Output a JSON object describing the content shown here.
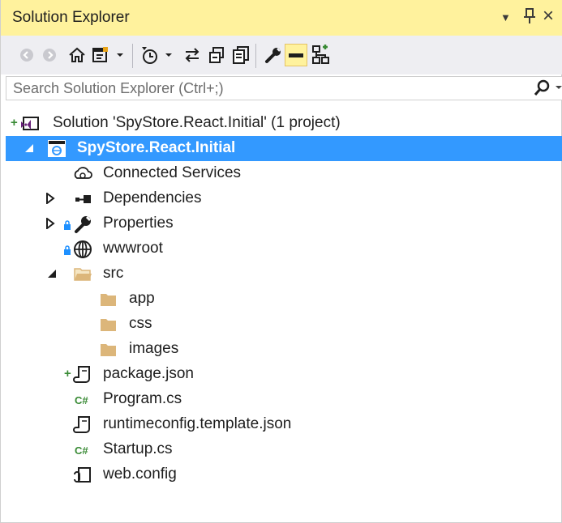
{
  "window": {
    "title": "Solution Explorer",
    "controls": {
      "dropdown": "▼",
      "pin": "ᛘ",
      "close": "×"
    }
  },
  "toolbar": {
    "buttons": [
      "back-icon",
      "forward-icon",
      "home-icon",
      "switch-views-icon",
      "dropdown-icon",
      "pending-changes-icon",
      "sync-icon",
      "collapse-all-icon",
      "show-all-files-icon",
      "properties-icon",
      "preview-icon",
      "view-class-diagram-icon"
    ]
  },
  "search": {
    "placeholder": "Search Solution Explorer (Ctrl+;)"
  },
  "tree": {
    "solution": "Solution 'SpyStore.React.Initial' (1 project)",
    "project": "SpyStore.React.Initial",
    "connected_services": "Connected Services",
    "dependencies": "Dependencies",
    "properties": "Properties",
    "wwwroot": "wwwroot",
    "src": "src",
    "app": "app",
    "css": "css",
    "images": "images",
    "package_json": "package.json",
    "program_cs": "Program.cs",
    "runtimeconfig": "runtimeconfig.template.json",
    "startup_cs": "Startup.cs",
    "web_config": "web.config"
  },
  "colors": {
    "title_bar": "#fff29d",
    "selection": "#3399ff",
    "folder": "#dcb67a",
    "csharp": "#388a34",
    "added": "#388a34",
    "lock": "#1e90ff"
  }
}
